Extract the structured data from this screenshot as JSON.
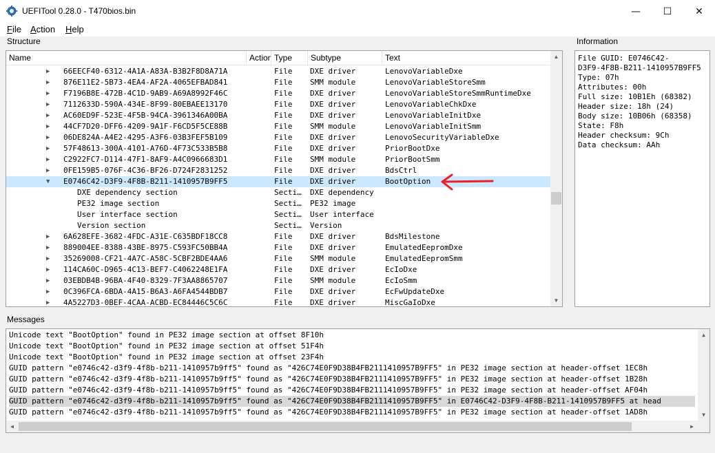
{
  "window": {
    "title": "UEFITool 0.28.0 - T470bios.bin",
    "minimize": "—",
    "maximize": "☐",
    "close": "✕"
  },
  "menu": {
    "items": [
      {
        "accel": "F",
        "rest": "ile"
      },
      {
        "accel": "A",
        "rest": "ction"
      },
      {
        "accel": "H",
        "rest": "elp"
      }
    ]
  },
  "structure": {
    "label": "Structure",
    "columns": [
      "Name",
      "Action",
      "Type",
      "Subtype",
      "Text"
    ],
    "rows": [
      {
        "name": "66EECF40-6312-4A1A-A83A-B3B2F8D8A71A",
        "action": "",
        "type": "File",
        "subtype": "DXE driver",
        "text": "LenovoVariableDxe",
        "indent": 1,
        "expander": "right"
      },
      {
        "name": "876E11E2-5B73-4EA4-AF2A-4065EFBAD841",
        "action": "",
        "type": "File",
        "subtype": "SMM module",
        "text": "LenovoVariableStoreSmm",
        "indent": 1,
        "expander": "right"
      },
      {
        "name": "F7196B8E-472B-4C1D-9AB9-A69A8992F46C",
        "action": "",
        "type": "File",
        "subtype": "DXE driver",
        "text": "LenovoVariableStoreSmmRuntimeDxe",
        "indent": 1,
        "expander": "right"
      },
      {
        "name": "7112633D-590A-434E-8F99-80EBAEE13170",
        "action": "",
        "type": "File",
        "subtype": "DXE driver",
        "text": "LenovoVariableChkDxe",
        "indent": 1,
        "expander": "right"
      },
      {
        "name": "AC60ED9F-523E-4F5B-94CA-3961346A00BA",
        "action": "",
        "type": "File",
        "subtype": "DXE driver",
        "text": "LenovoVariableInitDxe",
        "indent": 1,
        "expander": "right"
      },
      {
        "name": "44CF7D20-DFF6-4209-9A1F-F6CD5F5CE88B",
        "action": "",
        "type": "File",
        "subtype": "SMM module",
        "text": "LenovoVariableInitSmm",
        "indent": 1,
        "expander": "right"
      },
      {
        "name": "06DE824A-A4E2-4295-A3F6-03B3FEF5B109",
        "action": "",
        "type": "File",
        "subtype": "DXE driver",
        "text": "LenovoSecurityVariableDxe",
        "indent": 1,
        "expander": "right"
      },
      {
        "name": "57F48613-300A-4101-A76D-4F73C533B5B8",
        "action": "",
        "type": "File",
        "subtype": "DXE driver",
        "text": "PriorBootDxe",
        "indent": 1,
        "expander": "right"
      },
      {
        "name": "C2922FC7-D114-47F1-8AF9-A4C0966683D1",
        "action": "",
        "type": "File",
        "subtype": "SMM module",
        "text": "PriorBootSmm",
        "indent": 1,
        "expander": "right"
      },
      {
        "name": "0FE159B5-076F-4C36-BF26-D724F2831252",
        "action": "",
        "type": "File",
        "subtype": "DXE driver",
        "text": "BdsCtrl",
        "indent": 1,
        "expander": "right"
      },
      {
        "name": "E0746C42-D3F9-4F8B-B211-1410957B9FF5",
        "action": "",
        "type": "File",
        "subtype": "DXE driver",
        "text": "BootOption",
        "indent": 1,
        "expander": "down",
        "selected": true
      },
      {
        "name": "DXE dependency section",
        "action": "",
        "type": "Secti…",
        "subtype": "DXE dependency",
        "text": "",
        "indent": 2,
        "expander": ""
      },
      {
        "name": "PE32 image section",
        "action": "",
        "type": "Secti…",
        "subtype": "PE32 image",
        "text": "",
        "indent": 2,
        "expander": ""
      },
      {
        "name": "User interface section",
        "action": "",
        "type": "Secti…",
        "subtype": "User interface",
        "text": "",
        "indent": 2,
        "expander": ""
      },
      {
        "name": "Version section",
        "action": "",
        "type": "Secti…",
        "subtype": "Version",
        "text": "",
        "indent": 2,
        "expander": ""
      },
      {
        "name": "6A628EFE-3682-4FDC-A31E-C635BDF18CC8",
        "action": "",
        "type": "File",
        "subtype": "DXE driver",
        "text": "BdsMilestone",
        "indent": 1,
        "expander": "right"
      },
      {
        "name": "889004EE-8388-43BE-8975-C593FC50BB4A",
        "action": "",
        "type": "File",
        "subtype": "DXE driver",
        "text": "EmulatedEepromDxe",
        "indent": 1,
        "expander": "right"
      },
      {
        "name": "35269008-CF21-4A7C-A58C-5CBF2BDE4AA6",
        "action": "",
        "type": "File",
        "subtype": "SMM module",
        "text": "EmulatedEepromSmm",
        "indent": 1,
        "expander": "right"
      },
      {
        "name": "114CA60C-D965-4C13-BEF7-C4062248E1FA",
        "action": "",
        "type": "File",
        "subtype": "DXE driver",
        "text": "EcIoDxe",
        "indent": 1,
        "expander": "right"
      },
      {
        "name": "03EBDB4B-96BA-4F40-8329-7F3AA8865707",
        "action": "",
        "type": "File",
        "subtype": "SMM module",
        "text": "EcIoSmm",
        "indent": 1,
        "expander": "right"
      },
      {
        "name": "0C396FCA-6BDA-4A15-B6A3-A6FA4544BDB7",
        "action": "",
        "type": "File",
        "subtype": "DXE driver",
        "text": "EcFwUpdateDxe",
        "indent": 1,
        "expander": "right"
      },
      {
        "name": "4A5227D3-0BEF-4CAA-ACBD-EC84446C5C6C",
        "action": "",
        "type": "File",
        "subtype": "DXE driver",
        "text": "MiscGaIoDxe",
        "indent": 1,
        "expander": "right"
      }
    ]
  },
  "information": {
    "label": "Information",
    "lines": [
      "File GUID: E0746C42-",
      "D3F9-4F8B-B211-1410957B9FF5",
      "Type: 07h",
      "Attributes: 00h",
      "Full size: 10B1Eh (68382)",
      "Header size: 18h (24)",
      "Body size: 10B06h (68358)",
      "State: F8h",
      "Header checksum: 9Ch",
      "Data checksum: AAh"
    ]
  },
  "messages": {
    "label": "Messages",
    "lines": [
      "Unicode text \"BootOption\" found in PE32 image section at offset 8F10h",
      "Unicode text \"BootOption\" found in PE32 image section at offset 51F4h",
      "Unicode text \"BootOption\" found in PE32 image section at offset 23F4h",
      "GUID pattern \"e0746c42-d3f9-4f8b-b211-1410957b9ff5\" found as \"426C74E0F9D38B4FB2111410957B9FF5\" in PE32 image section at header-offset 1EC8h",
      "GUID pattern \"e0746c42-d3f9-4f8b-b211-1410957b9ff5\" found as \"426C74E0F9D38B4FB2111410957B9FF5\" in PE32 image section at header-offset 1B28h",
      "GUID pattern \"e0746c42-d3f9-4f8b-b211-1410957b9ff5\" found as \"426C74E0F9D38B4FB2111410957B9FF5\" in PE32 image section at header-offset AF04h",
      "GUID pattern \"e0746c42-d3f9-4f8b-b211-1410957b9ff5\" found as \"426C74E0F9D38B4FB2111410957B9FF5\" in E0746C42-D3F9-4F8B-B211-1410957B9FF5 at head",
      "GUID pattern \"e0746c42-d3f9-4f8b-b211-1410957b9ff5\" found as \"426C74E0F9D38B4FB2111410957B9FF5\" in PE32 image section at header-offset 1AD8h"
    ],
    "selected_index": 6
  },
  "colors": {
    "selection": "#cce8ff",
    "annotation_arrow": "#e8202a"
  }
}
